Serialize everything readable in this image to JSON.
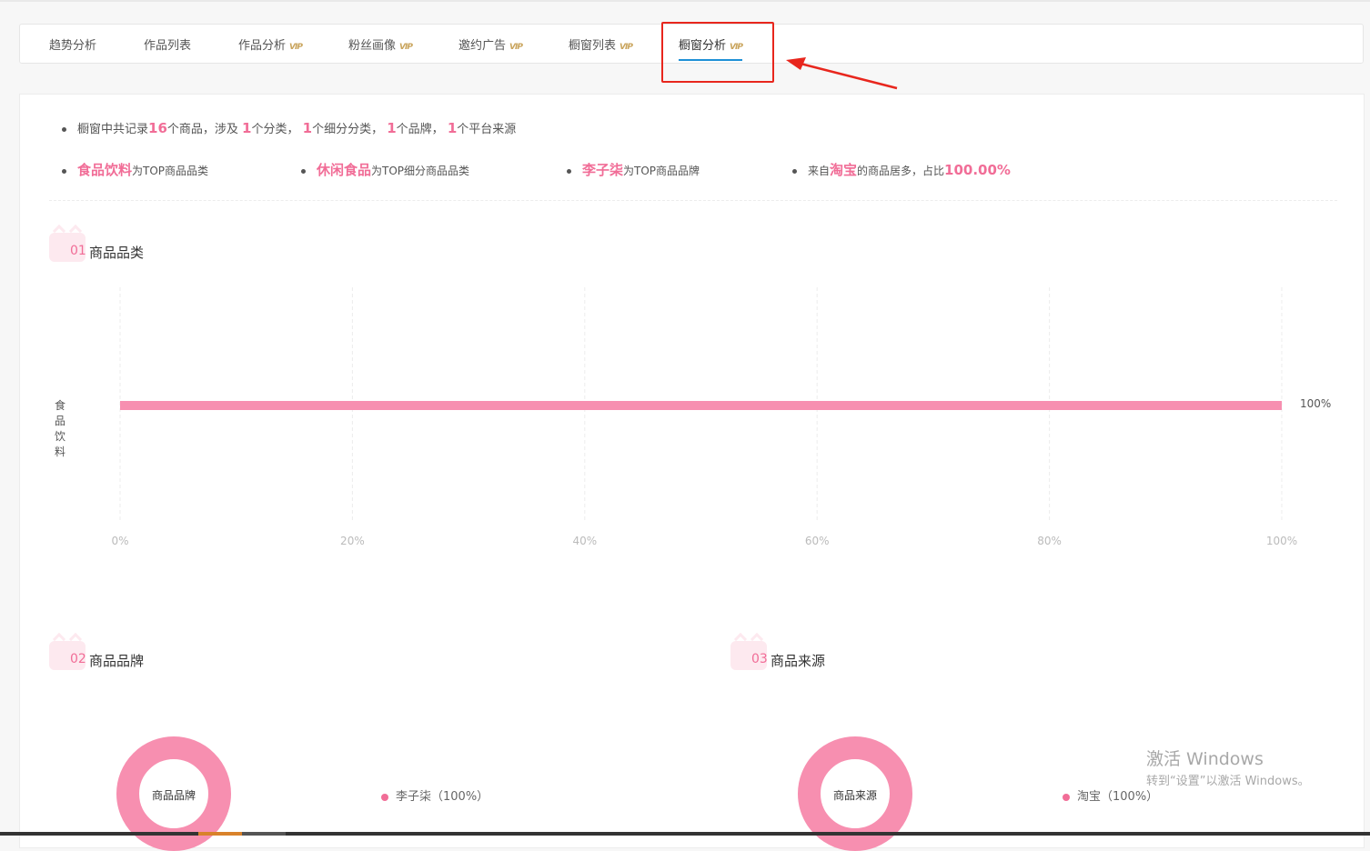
{
  "tabs": [
    {
      "label": "趋势分析",
      "vip": ""
    },
    {
      "label": "作品列表",
      "vip": ""
    },
    {
      "label": "作品分析",
      "vip": "VIP"
    },
    {
      "label": "粉丝画像",
      "vip": "VIP"
    },
    {
      "label": "邀约广告",
      "vip": "VIP"
    },
    {
      "label": "橱窗列表",
      "vip": "VIP"
    },
    {
      "label": "橱窗分析",
      "vip": "VIP"
    }
  ],
  "summary": {
    "line1": {
      "p1": "橱窗中共记录",
      "goods_count": "16",
      "p2": "个商品，涉及",
      "category_count": "1",
      "p3": "个分类，",
      "subcategory_count": "1",
      "p4": "个细分分类，",
      "brand_count": "1",
      "p5": "个品牌，",
      "platform_count": "1",
      "p6": "个平台来源"
    },
    "top_category": {
      "value": "食品饮料",
      "text": "为TOP商品品类"
    },
    "top_subcategory": {
      "value": "休闲食品",
      "text": "为TOP细分商品品类"
    },
    "top_brand": {
      "value": "李子柒",
      "text": "为TOP商品品牌"
    },
    "top_source": {
      "p1": "来自",
      "value": "淘宝",
      "p2": "的商品居多，占比",
      "percent": "100.00%"
    }
  },
  "sections": {
    "category": {
      "num": "01",
      "title": "商品品类"
    },
    "brand": {
      "num": "02",
      "title": "商品品牌"
    },
    "source": {
      "num": "03",
      "title": "商品来源"
    }
  },
  "chart_data": [
    {
      "type": "bar",
      "orientation": "horizontal",
      "categories": [
        "食品饮料"
      ],
      "values": [
        100
      ],
      "value_labels": [
        "100%"
      ],
      "xlim": [
        0,
        100
      ],
      "xticks": [
        "0%",
        "20%",
        "40%",
        "60%",
        "80%",
        "100%"
      ],
      "grid": true,
      "color": "#f78fb0"
    },
    {
      "type": "pie",
      "center_label": "商品品牌",
      "slices": [
        {
          "label": "李子柒（100%）",
          "value": 100
        }
      ],
      "color": "#f78fb0"
    },
    {
      "type": "pie",
      "center_label": "商品来源",
      "slices": [
        {
          "label": "淘宝（100%）",
          "value": 100
        }
      ],
      "color": "#f78fb0"
    }
  ],
  "watermark": {
    "line1": "激活 Windows",
    "line2": "转到“设置”以激活 Windows。"
  }
}
